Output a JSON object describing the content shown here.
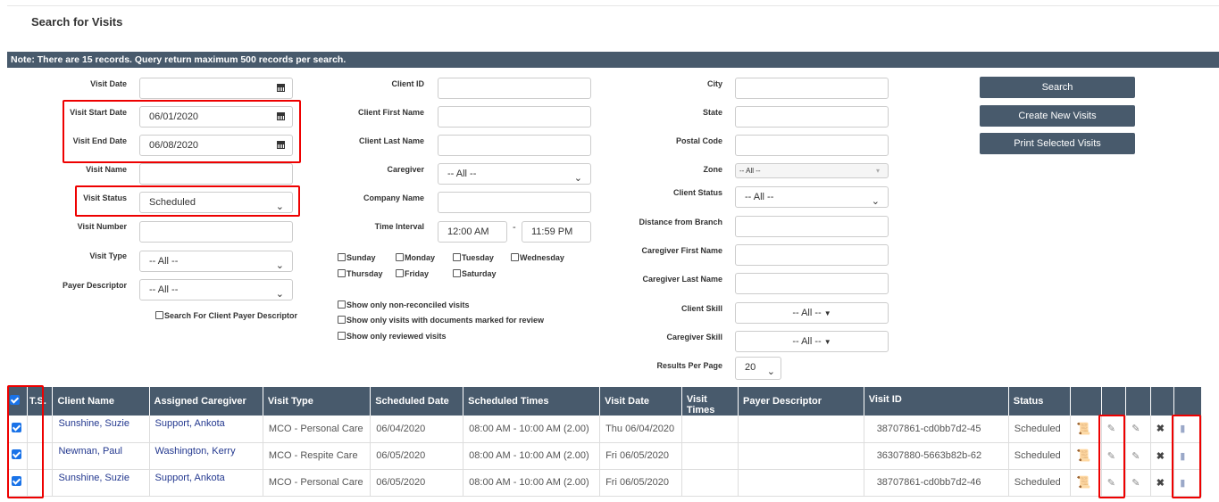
{
  "page_title": "Search for Visits",
  "note": "Note: There are 15 records. Query return maximum 500 records per search.",
  "col1": {
    "visit_date": {
      "label": "Visit Date",
      "value": ""
    },
    "visit_start_date": {
      "label": "Visit Start Date",
      "value": "06/01/2020"
    },
    "visit_end_date": {
      "label": "Visit End Date",
      "value": "06/08/2020"
    },
    "visit_name": {
      "label": "Visit Name",
      "value": ""
    },
    "visit_status": {
      "label": "Visit Status",
      "value": "Scheduled"
    },
    "visit_number": {
      "label": "Visit Number",
      "value": ""
    },
    "visit_type": {
      "label": "Visit Type",
      "value": "-- All --"
    },
    "payer_descriptor": {
      "label": "Payer Descriptor",
      "value": "-- All --"
    },
    "search_client_payer": "Search For Client Payer Descriptor"
  },
  "col2": {
    "client_id": {
      "label": "Client ID",
      "value": ""
    },
    "client_first_name": {
      "label": "Client First Name",
      "value": ""
    },
    "client_last_name": {
      "label": "Client Last Name",
      "value": ""
    },
    "caregiver": {
      "label": "Caregiver",
      "value": "-- All --"
    },
    "company_name": {
      "label": "Company Name",
      "value": ""
    },
    "time_interval": {
      "label": "Time Interval",
      "from": "12:00 AM",
      "sep": "-",
      "to": "11:59 PM"
    },
    "days": [
      "Sunday",
      "Monday",
      "Tuesday",
      "Wednesday",
      "Thursday",
      "Friday",
      "Saturday"
    ],
    "show_nonreconciled": "Show only non-reconciled visits",
    "show_docs_review": "Show only visits with documents marked for review",
    "show_reviewed": "Show only reviewed visits"
  },
  "col3": {
    "city": {
      "label": "City",
      "value": ""
    },
    "state": {
      "label": "State",
      "value": ""
    },
    "postal_code": {
      "label": "Postal Code",
      "value": ""
    },
    "zone": {
      "label": "Zone",
      "value": "-- All --"
    },
    "client_status": {
      "label": "Client Status",
      "value": "-- All --"
    },
    "distance": {
      "label": "Distance from Branch",
      "value": ""
    },
    "caregiver_first_name": {
      "label": "Caregiver First Name",
      "value": ""
    },
    "caregiver_last_name": {
      "label": "Caregiver Last Name",
      "value": ""
    },
    "client_skill": {
      "label": "Client Skill",
      "value": "-- All --"
    },
    "caregiver_skill": {
      "label": "Caregiver Skill",
      "value": "-- All --"
    },
    "results_per_page": {
      "label": "Results Per Page",
      "value": "20"
    }
  },
  "buttons": {
    "search": "Search",
    "create": "Create New Visits",
    "print": "Print Selected Visits"
  },
  "table": {
    "headers": [
      "T.S.",
      "Client Name",
      "Assigned Caregiver",
      "Visit Type",
      "Scheduled Date",
      "Scheduled Times",
      "Visit Date",
      "Visit Times",
      "Payer Descriptor",
      "Visit ID",
      "Status"
    ],
    "rows": [
      {
        "client": "Sunshine, Suzie",
        "caregiver": "Support, Ankota",
        "visit_type": "MCO - Personal Care",
        "sched_date": "06/04/2020",
        "sched_times": "08:00 AM - 10:00 AM (2.00)",
        "visit_date": "Thu 06/04/2020",
        "visit_times": "",
        "payer": "",
        "visit_id": "38707861-cd0bb7d2-45",
        "status": "Scheduled"
      },
      {
        "client": "Newman, Paul",
        "caregiver": "Washington, Kerry",
        "visit_type": "MCO - Respite Care",
        "sched_date": "06/05/2020",
        "sched_times": "08:00 AM - 10:00 AM (2.00)",
        "visit_date": "Fri 06/05/2020",
        "visit_times": "",
        "payer": "",
        "visit_id": "36307880-5663b82b-62",
        "status": "Scheduled"
      },
      {
        "client": "Sunshine, Suzie",
        "caregiver": "Support, Ankota",
        "visit_type": "MCO - Personal Care",
        "sched_date": "06/05/2020",
        "sched_times": "08:00 AM - 10:00 AM (2.00)",
        "visit_date": "Fri 06/05/2020",
        "visit_times": "",
        "payer": "",
        "visit_id": "38707861-cd0bb7d2-46",
        "status": "Scheduled"
      }
    ]
  },
  "colors": {
    "header_bg": "#485a6c",
    "highlight": "#e00000",
    "link": "#23388f",
    "check": "#1a73e8"
  }
}
